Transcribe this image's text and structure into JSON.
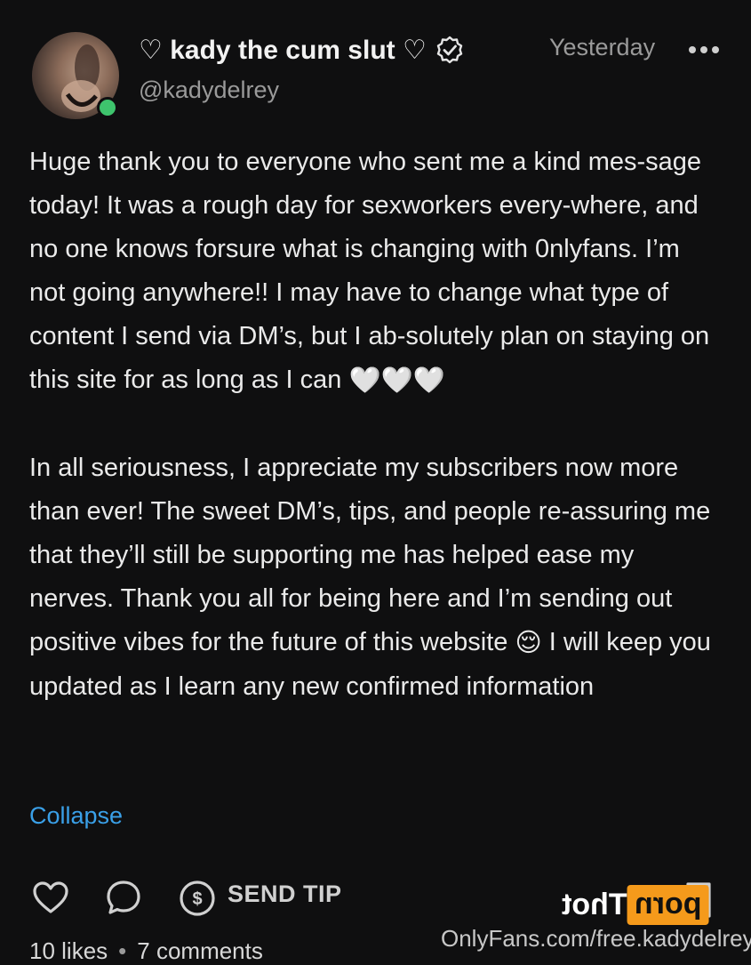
{
  "header": {
    "display_name": "♡ kady the cum slut ♡",
    "handle": "@kadydelrey",
    "timestamp": "Yesterday",
    "verified_icon": "verified-badge-icon",
    "more_icon": "more-dots-icon"
  },
  "post": {
    "paragraph_1": "Huge thank you to everyone who sent me a kind mes-sage today! It was a rough day for sexworkers every-where, and no one knows forsure what is changing with 0nlyfans. I’m not going anywhere!! I may have to change what type of content I send via DM’s, but I ab-solutely plan on staying on this site for as long as I can",
    "paragraph_1_emoji": "🤍🤍🤍",
    "paragraph_2_before": "In all seriousness, I appreciate my subscribers now more than ever! The sweet DM’s, tips, and people re-assuring me that they’ll still be supporting me has helped ease my nerves. Thank you all for being here and I’m sending out positive vibes for the future of this website",
    "paragraph_2_emoji": "😌",
    "paragraph_2_after": "I will keep you updated as I learn any new confirmed information",
    "collapse_label": "Collapse"
  },
  "actions": {
    "like_icon": "heart-icon",
    "comment_icon": "comment-icon",
    "tip_icon": "dollar-circle-icon",
    "send_tip_label": "SEND TIP",
    "bookmark_icon": "bookmark-icon"
  },
  "stats": {
    "likes": "10 likes",
    "separator": "•",
    "comments": "7 comments"
  },
  "watermark": {
    "logo_box": "porn",
    "logo_text": "Thot",
    "url": "OnlyFans.com/free.kadydelrey"
  },
  "colors": {
    "background": "#0f0f10",
    "link": "#3aa0e8",
    "online": "#3ec46d",
    "watermark_accent": "#f59a1b"
  }
}
